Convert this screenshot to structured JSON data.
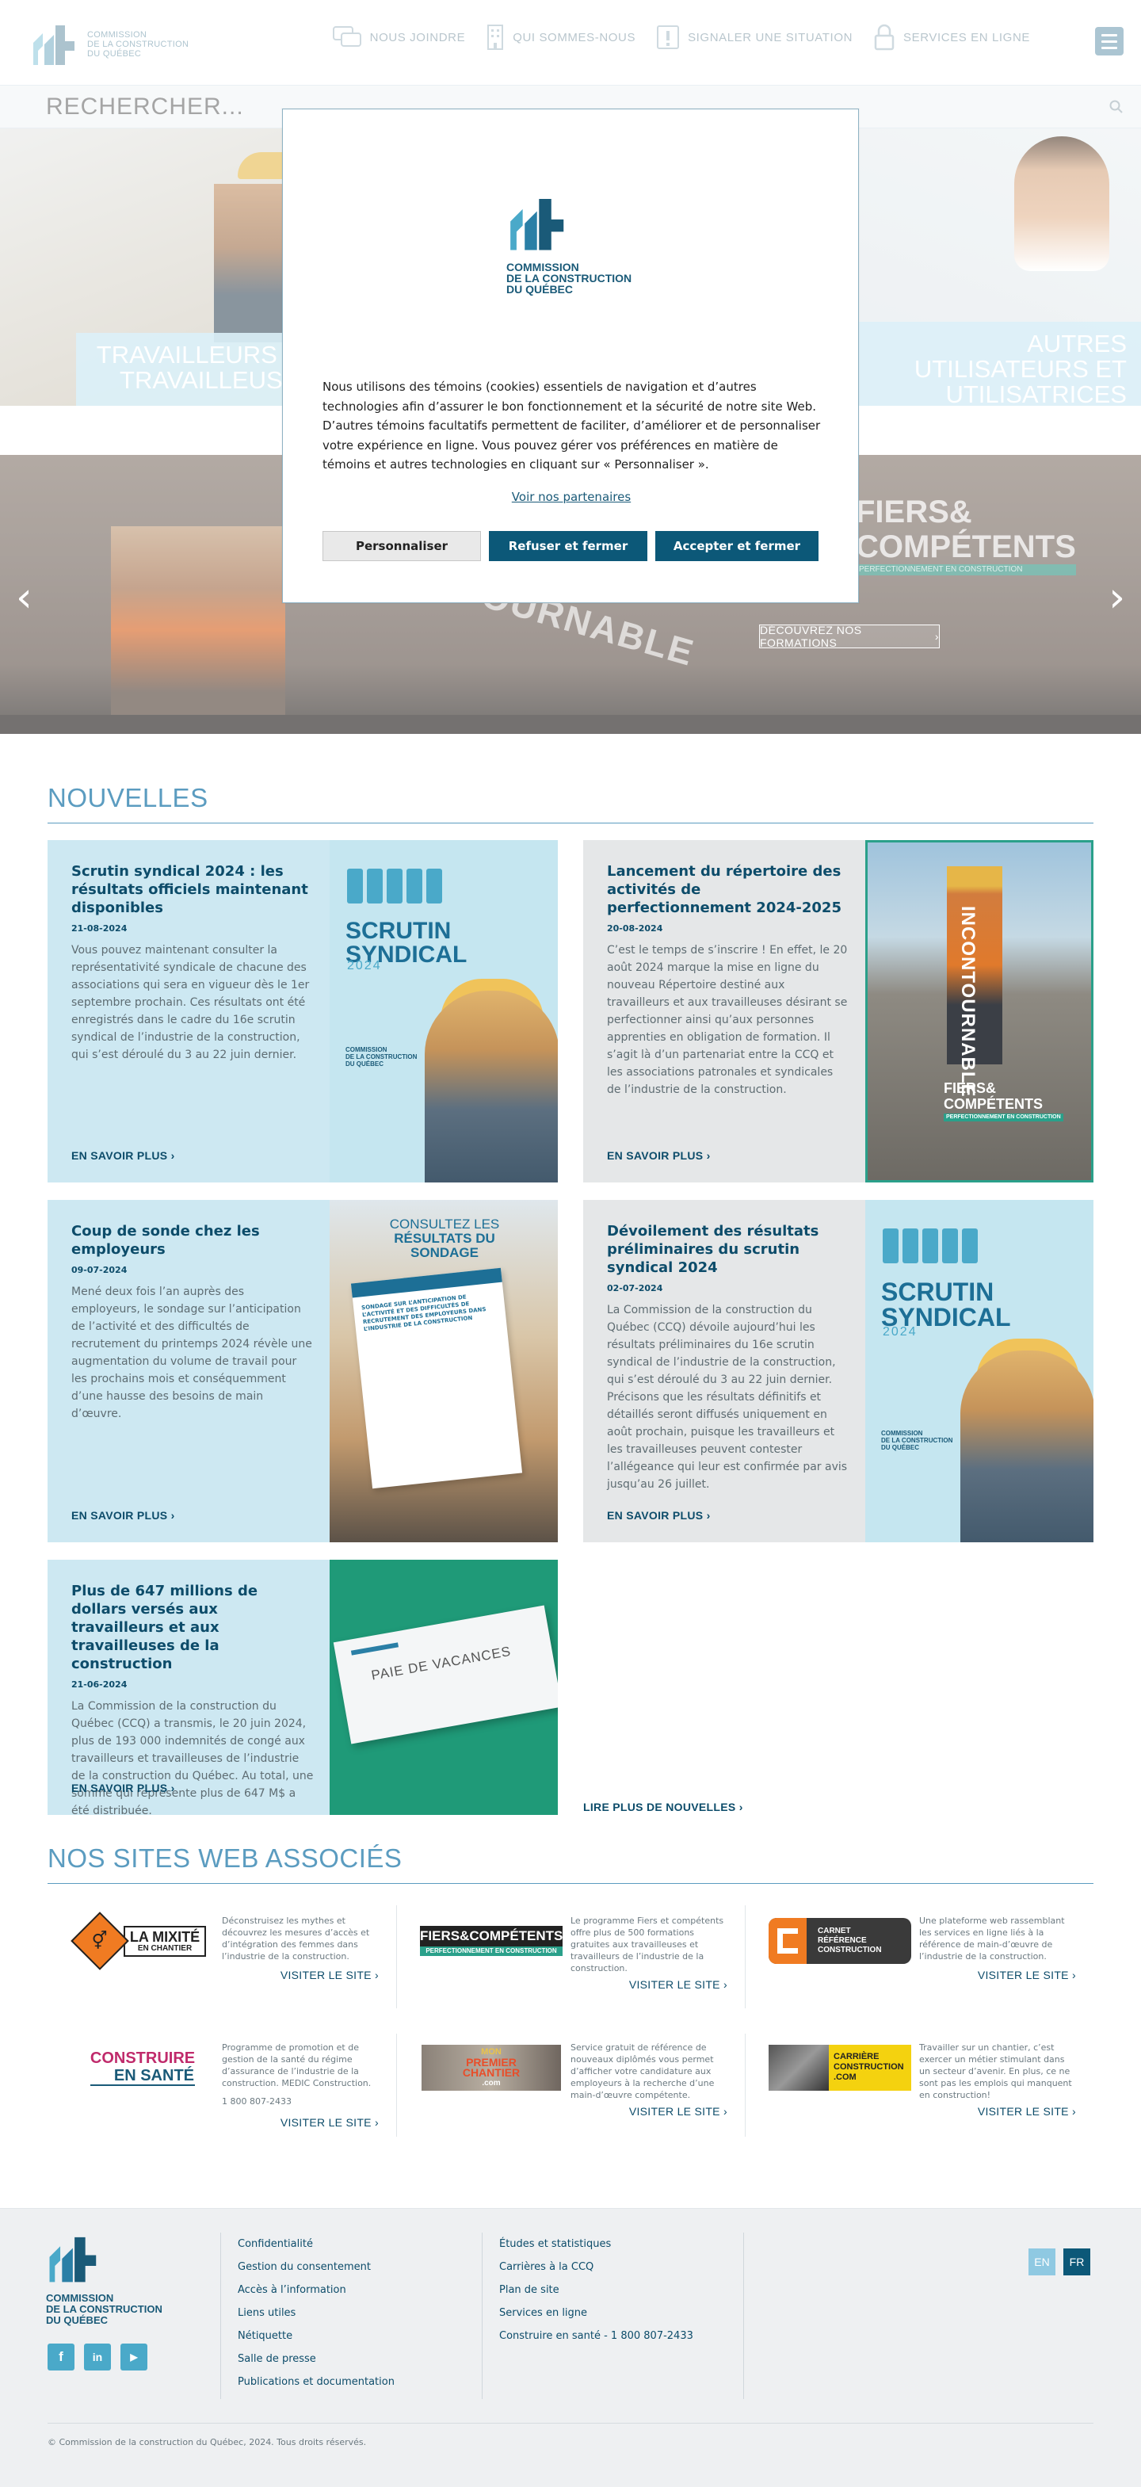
{
  "header": {
    "logo_text": [
      "COMMISSION",
      "DE LA CONSTRUCTION",
      "DU QUÉBEC"
    ],
    "nav": [
      {
        "label": "NOUS JOINDRE",
        "icon": "chat-icon"
      },
      {
        "label": "QUI SOMMES-NOUS",
        "icon": "building-icon"
      },
      {
        "label": "SIGNALER UNE SITUATION",
        "icon": "alert-icon"
      },
      {
        "label": "SERVICES EN LIGNE",
        "icon": "lock-icon"
      }
    ],
    "menu_icon": "hamburger-icon"
  },
  "search": {
    "placeholder": "RECHERCHER..."
  },
  "audience": {
    "left_label": [
      "TRAVAILLEURS ET",
      "TRAVAILLEUSES"
    ],
    "right_label": [
      "AUTRES",
      "UTILISATEURS ET",
      "UTILISATRICES"
    ]
  },
  "hero": {
    "brand_line1": "FIERS&",
    "brand_line2": "COMPÉTENTS",
    "brand_sub": "PERFECTIONNEMENT EN CONSTRUCTION",
    "plank_text": "INCONTOURNABLE",
    "cta": "DÉCOUVREZ NOS FORMATIONS",
    "prev": "‹",
    "next": "›"
  },
  "cookie": {
    "logo_text": [
      "COMMISSION",
      "DE LA CONSTRUCTION",
      "DU QUÉBEC"
    ],
    "text": "Nous utilisons des témoins (cookies) essentiels de navigation et d’autres technologies afin d’assurer le bon fonctionnement et la sécurité de notre site Web. D’autres témoins facultatifs permettent de faciliter, d’améliorer et de personnaliser votre expérience en ligne. Vous pouvez gérer vos préférences en matière de témoins et autres technologies en cliquant sur « Personnaliser ».",
    "partners": "Voir nos partenaires",
    "btn_customize": "Personnaliser",
    "btn_refuse": "Refuser et fermer",
    "btn_accept": "Accepter et fermer"
  },
  "news": {
    "title": "NOUVELLES",
    "items": [
      {
        "title": "Scrutin syndical 2024 : les résultats officiels maintenant disponibles",
        "date": "21-08-2024",
        "body": "Vous pouvez maintenant consulter la représentativité syndicale de chacune des associations qui sera en vigueur dès le 1er septembre prochain. Ces résultats ont été enregistrés dans le cadre du 16e scrutin syndical de l’industrie de la construction, qui s’est déroulé du 3 au 22 juin dernier.",
        "more": "EN SAVOIR PLUS"
      },
      {
        "title": "Lancement du répertoire des activités de perfectionnement 2024-2025",
        "date": "20-08-2024",
        "body": "C’est le temps de s’inscrire ! En effet, le 20 août 2024 marque la mise en ligne du nouveau Répertoire destiné aux travailleurs et aux travailleuses désirant se perfectionner ainsi qu’aux personnes apprenties en obligation de formation. Il s’agit là d’un partenariat entre la CCQ et les associations patronales et syndicales de l’industrie de la construction.",
        "more": "EN SAVOIR PLUS"
      },
      {
        "title": "Coup de sonde chez les employeurs",
        "date": "09-07-2024",
        "body": "Mené deux fois l’an auprès des employeurs, le sondage sur l’anticipation de l’activité et des difficultés de recrutement du printemps 2024 révèle une augmentation du volume de travail pour les prochains mois et conséquemment d’une hausse des besoins de main d’œuvre.",
        "more": "EN SAVOIR PLUS"
      },
      {
        "title": "Dévoilement des résultats préliminaires du scrutin syndical 2024",
        "date": "02-07-2024",
        "body": "La Commission de la construction du Québec (CCQ) dévoile aujourd’hui les résultats préliminaires du 16e scrutin syndical de l’industrie de la construction, qui s’est déroulé du 3 au 22 juin dernier. Précisons que les résultats définitifs et détaillés seront diffusés uniquement en août prochain, puisque les travailleurs et les travailleuses peuvent contester l’allégeance qui leur est confirmée par avis jusqu’au 26 juillet.",
        "more": "EN SAVOIR PLUS"
      },
      {
        "title": "Plus de 647 millions de dollars versés aux travailleurs et aux travailleuses de la construction",
        "date": "21-06-2024",
        "body": "La Commission de la construction du Québec (CCQ) a transmis, le 20 juin 2024, plus de 193 000 indemnités de congé aux travailleurs et travailleuses de l’industrie de la construction du Québec. Au total, une somme qui représente plus de 647 M$ a été distribuée.",
        "more": "EN SAVOIR PLUS"
      }
    ],
    "scrutin_big": [
      "SCRUTIN",
      "SYNDICAL"
    ],
    "scrutin_year": "2024",
    "scrutin_logo": [
      "COMMISSION",
      "DE LA CONSTRUCTION",
      "DU QUÉBEC"
    ],
    "sondage_head": [
      "CONSULTEZ LES",
      "RÉSULTATS DU",
      "SONDAGE"
    ],
    "sondage_doc": "SONDAGE SUR L’ANTICIPATION DE L’ACTIVITÉ ET DES DIFFICULTÉS DE RECRUTEMENT DES EMPLOYEURS DANS L’INDUSTRIE DE LA CONSTRUCTION",
    "paie": "PAIE DE VACANCES",
    "fc_plank": "INCONTOURNABLE",
    "fc_brand": [
      "FIERS&",
      "COMPÉTENTS"
    ],
    "fc_sub": "PERFECTIONNEMENT EN CONSTRUCTION",
    "read_more": "LIRE PLUS DE NOUVELLES"
  },
  "partners": {
    "title": "NOS SITES WEB ASSOCIÉS",
    "visit": "VISITER LE SITE",
    "items": [
      {
        "logo": [
          "LA MIXITÉ",
          "EN CHANTIER"
        ],
        "desc": "Déconstruisez les mythes et découvrez les mesures d’accès et d’intégration des femmes dans l’industrie de la construction."
      },
      {
        "logo": [
          "FIERS&COMPÉTENTS",
          "PERFECTIONNEMENT EN CONSTRUCTION"
        ],
        "desc": "Le programme Fiers et compétents offre plus de 500 formations gratuites aux travailleuses et travailleurs de l’industrie de la construction."
      },
      {
        "logo": [
          "CARNET",
          "RÉFÉRENCE",
          "CONSTRUCTION"
        ],
        "desc": "Une plateforme web rassemblant les services en ligne liés à la référence de main-d’œuvre de l’industrie de la construction."
      },
      {
        "logo": [
          "CONSTRUIRE",
          "EN SANTÉ"
        ],
        "desc": "Programme de promotion et de gestion de la santé du régime d’assurance de l’industrie de la construction. MEDIC Construction.",
        "phone": "1 800 807-2433"
      },
      {
        "logo": [
          "MON",
          "PREMIER",
          "CHANTIER",
          ".com"
        ],
        "desc": "Service gratuit de référence de nouveaux diplômés vous permet d’afficher votre candidature aux employeurs à la recherche d’une main-d’œuvre compétente."
      },
      {
        "logo": [
          "CARRIÈRE",
          "CONSTRUCTION",
          ".COM"
        ],
        "desc": "Travailler sur un chantier, c’est exercer un métier stimulant dans un secteur d’avenir. En plus, ce ne sont pas les emplois qui manquent en construction!"
      }
    ]
  },
  "footer": {
    "logo_text": [
      "COMMISSION",
      "DE LA CONSTRUCTION",
      "DU QUÉBEC"
    ],
    "social": [
      "f",
      "in",
      "▶"
    ],
    "col1": [
      "Confidentialité",
      "Gestion du consentement",
      "Accès à l’information",
      "Liens utiles",
      "Nétiquette",
      "Salle de presse",
      "Publications et documentation"
    ],
    "col2": [
      "Études et statistiques",
      "Carrières à la CCQ",
      "Plan de site",
      "Services en ligne",
      "Construire en santé - 1 800 807-2433"
    ],
    "lang_en": "EN",
    "lang_fr": "FR",
    "copyright": "© Commission de la construction du Québec, 2024. Tous droits réservés."
  }
}
